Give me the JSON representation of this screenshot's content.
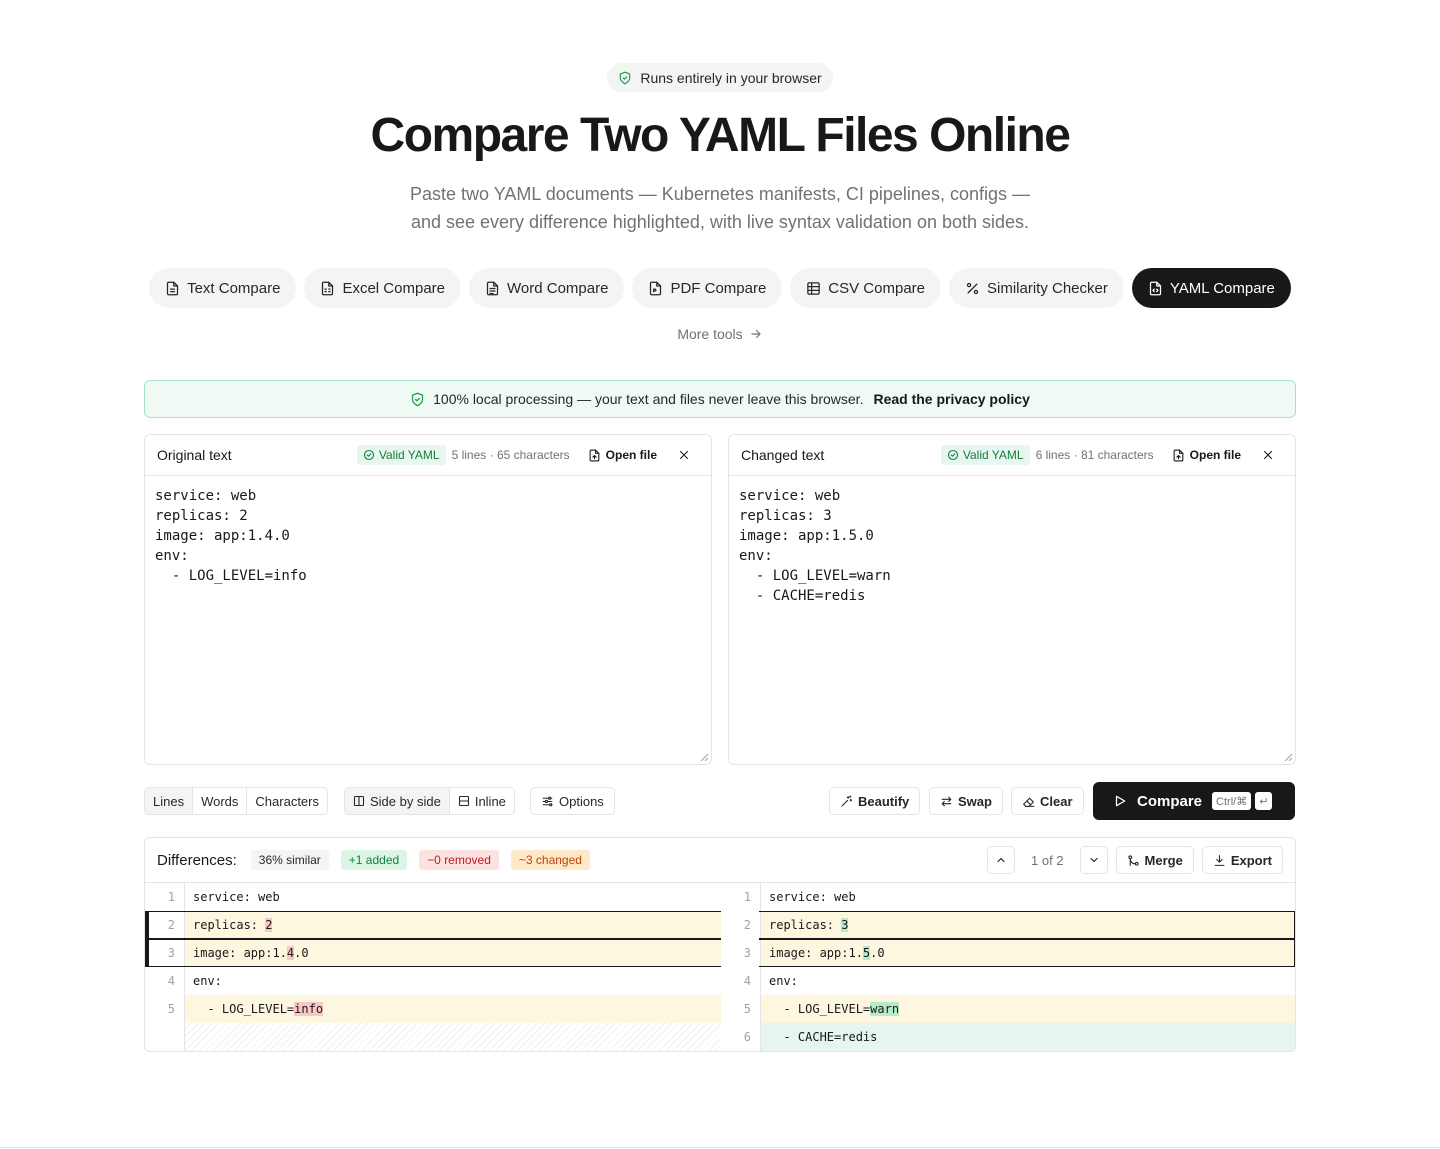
{
  "hero": {
    "badge": "Runs entirely in your browser",
    "title": "Compare Two YAML Files Online",
    "subtitle_line1": "Paste two YAML documents — Kubernetes manifests, CI pipelines, configs —",
    "subtitle_line2": "and see every difference highlighted, with live syntax validation on both sides."
  },
  "tools": [
    {
      "label": "Text Compare",
      "icon": "file-text-icon"
    },
    {
      "label": "Excel Compare",
      "icon": "file-spreadsheet-icon"
    },
    {
      "label": "Word Compare",
      "icon": "file-icon"
    },
    {
      "label": "PDF Compare",
      "icon": "file-pdf-icon"
    },
    {
      "label": "CSV Compare",
      "icon": "table-icon"
    },
    {
      "label": "Similarity Checker",
      "icon": "percent-icon"
    },
    {
      "label": "YAML Compare",
      "icon": "file-code-icon",
      "active": true
    }
  ],
  "more_tools": "More tools",
  "privacy": {
    "text": "100% local processing — your text and files never leave this browser.",
    "link": "Read the privacy policy"
  },
  "original": {
    "label": "Original text",
    "valid": "Valid YAML",
    "stats": "5 lines · 65 characters",
    "open_file": "Open file",
    "content": "service: web\nreplicas: 2\nimage: app:1.4.0\nenv:\n  - LOG_LEVEL=info"
  },
  "changed": {
    "label": "Changed text",
    "valid": "Valid YAML",
    "stats": "6 lines · 81 characters",
    "open_file": "Open file",
    "content": "service: web\nreplicas: 3\nimage: app:1.5.0\nenv:\n  - LOG_LEVEL=warn\n  - CACHE=redis"
  },
  "toolbar": {
    "granularity": [
      "Lines",
      "Words",
      "Characters"
    ],
    "view_side": "Side by side",
    "view_inline": "Inline",
    "options": "Options",
    "beautify": "Beautify",
    "swap": "Swap",
    "clear": "Clear",
    "compare": "Compare",
    "shortcut": "Ctrl/⌘",
    "enter_key": "↵"
  },
  "results": {
    "label": "Differences:",
    "similar": "36% similar",
    "added": "+1 added",
    "removed": "−0 removed",
    "changed": "~3 changed",
    "position": "1 of 2",
    "merge": "Merge",
    "export": "Export"
  },
  "diff": {
    "left": [
      {
        "n": "1",
        "pre": "service: web",
        "hl": "",
        "post": "",
        "type": "same"
      },
      {
        "n": "2",
        "pre": "replicas: ",
        "hl": "2",
        "post": "",
        "type": "chg"
      },
      {
        "n": "3",
        "pre": "image: app:1.",
        "hl": "4",
        "post": ".0",
        "type": "chg"
      },
      {
        "n": "4",
        "pre": "env:",
        "hl": "",
        "post": "",
        "type": "same"
      },
      {
        "n": "5",
        "pre": "  - LOG_LEVEL=",
        "hl": "info",
        "post": "",
        "type": "chg"
      }
    ],
    "right": [
      {
        "n": "1",
        "pre": "service: web",
        "hl": "",
        "post": "",
        "type": "same"
      },
      {
        "n": "2",
        "pre": "replicas: ",
        "hl": "3",
        "post": "",
        "type": "chg"
      },
      {
        "n": "3",
        "pre": "image: app:1.",
        "hl": "5",
        "post": ".0",
        "type": "chg"
      },
      {
        "n": "4",
        "pre": "env:",
        "hl": "",
        "post": "",
        "type": "same"
      },
      {
        "n": "5",
        "pre": "  - LOG_LEVEL=",
        "hl": "warn",
        "post": "",
        "type": "chg"
      },
      {
        "n": "6",
        "pre": "  - CACHE=redis",
        "hl": "",
        "post": "",
        "type": "add"
      }
    ]
  },
  "colors": {
    "accent": "#18181b",
    "valid_green": "#15803d",
    "changed_bg": "#fef7e0",
    "added_bg": "#e6f6ee",
    "removed_hl": "#fac6c6",
    "added_hl": "#b7eac9"
  }
}
